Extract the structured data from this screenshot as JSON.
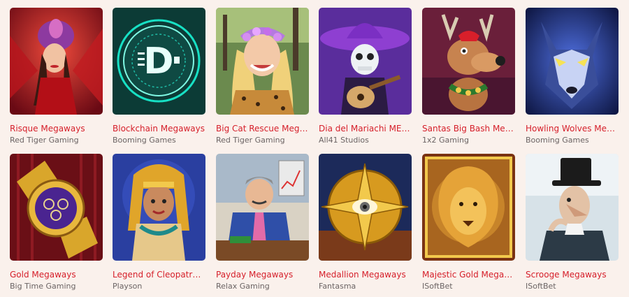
{
  "games": [
    {
      "title": "Risque Megaways",
      "provider": "Red Tiger Gaming",
      "icon": "burlesque-dancer"
    },
    {
      "title": "Blockchain Megaways",
      "provider": "Booming Games",
      "icon": "crypto-coin"
    },
    {
      "title": "Big Cat Rescue Megaways",
      "provider": "Red Tiger Gaming",
      "icon": "woman-flower-crown"
    },
    {
      "title": "Dia del Mariachi MEGAWAYS",
      "provider": "All41 Studios",
      "icon": "skeleton-mariachi"
    },
    {
      "title": "Santas Big Bash Megaways",
      "provider": "1x2 Gaming",
      "icon": "reindeer"
    },
    {
      "title": "Howling Wolves Megaways",
      "provider": "Booming Games",
      "icon": "wolf"
    },
    {
      "title": "Gold Megaways",
      "provider": "Big Time Gaming",
      "icon": "gold-watch"
    },
    {
      "title": "Legend of Cleopatra Megaways",
      "provider": "Playson",
      "icon": "cleopatra"
    },
    {
      "title": "Payday Megaways",
      "provider": "Relax Gaming",
      "icon": "businessman"
    },
    {
      "title": "Medallion Megaways",
      "provider": "Fantasma",
      "icon": "golden-medallion"
    },
    {
      "title": "Majestic Gold Megaways",
      "provider": "ISoftBet",
      "icon": "golden-lion"
    },
    {
      "title": "Scrooge Megaways",
      "provider": "ISoftBet",
      "icon": "scrooge"
    }
  ],
  "colors": {
    "background": "#faf1ec",
    "title": "#d6202b",
    "provider": "#6b6464"
  }
}
